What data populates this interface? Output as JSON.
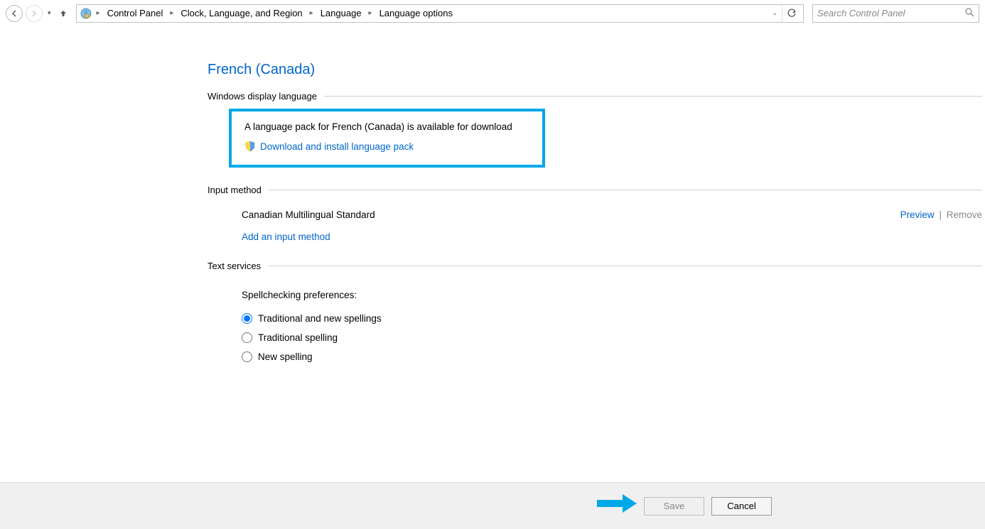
{
  "breadcrumb": {
    "items": [
      "Control Panel",
      "Clock, Language, and Region",
      "Language",
      "Language options"
    ]
  },
  "search": {
    "placeholder": "Search Control Panel"
  },
  "page": {
    "title": "French (Canada)"
  },
  "sections": {
    "display_language": {
      "header": "Windows display language",
      "pack_message": "A language pack for French (Canada) is available for download",
      "download_link": "Download and install language pack"
    },
    "input_method": {
      "header": "Input method",
      "method_name": "Canadian Multilingual Standard",
      "preview": "Preview",
      "remove": "Remove",
      "add_link": "Add an input method"
    },
    "text_services": {
      "header": "Text services",
      "spell_label": "Spellchecking preferences:",
      "options": [
        {
          "label": "Traditional and new spellings",
          "checked": true
        },
        {
          "label": "Traditional spelling",
          "checked": false
        },
        {
          "label": "New spelling",
          "checked": false
        }
      ]
    }
  },
  "footer": {
    "save": "Save",
    "cancel": "Cancel"
  }
}
